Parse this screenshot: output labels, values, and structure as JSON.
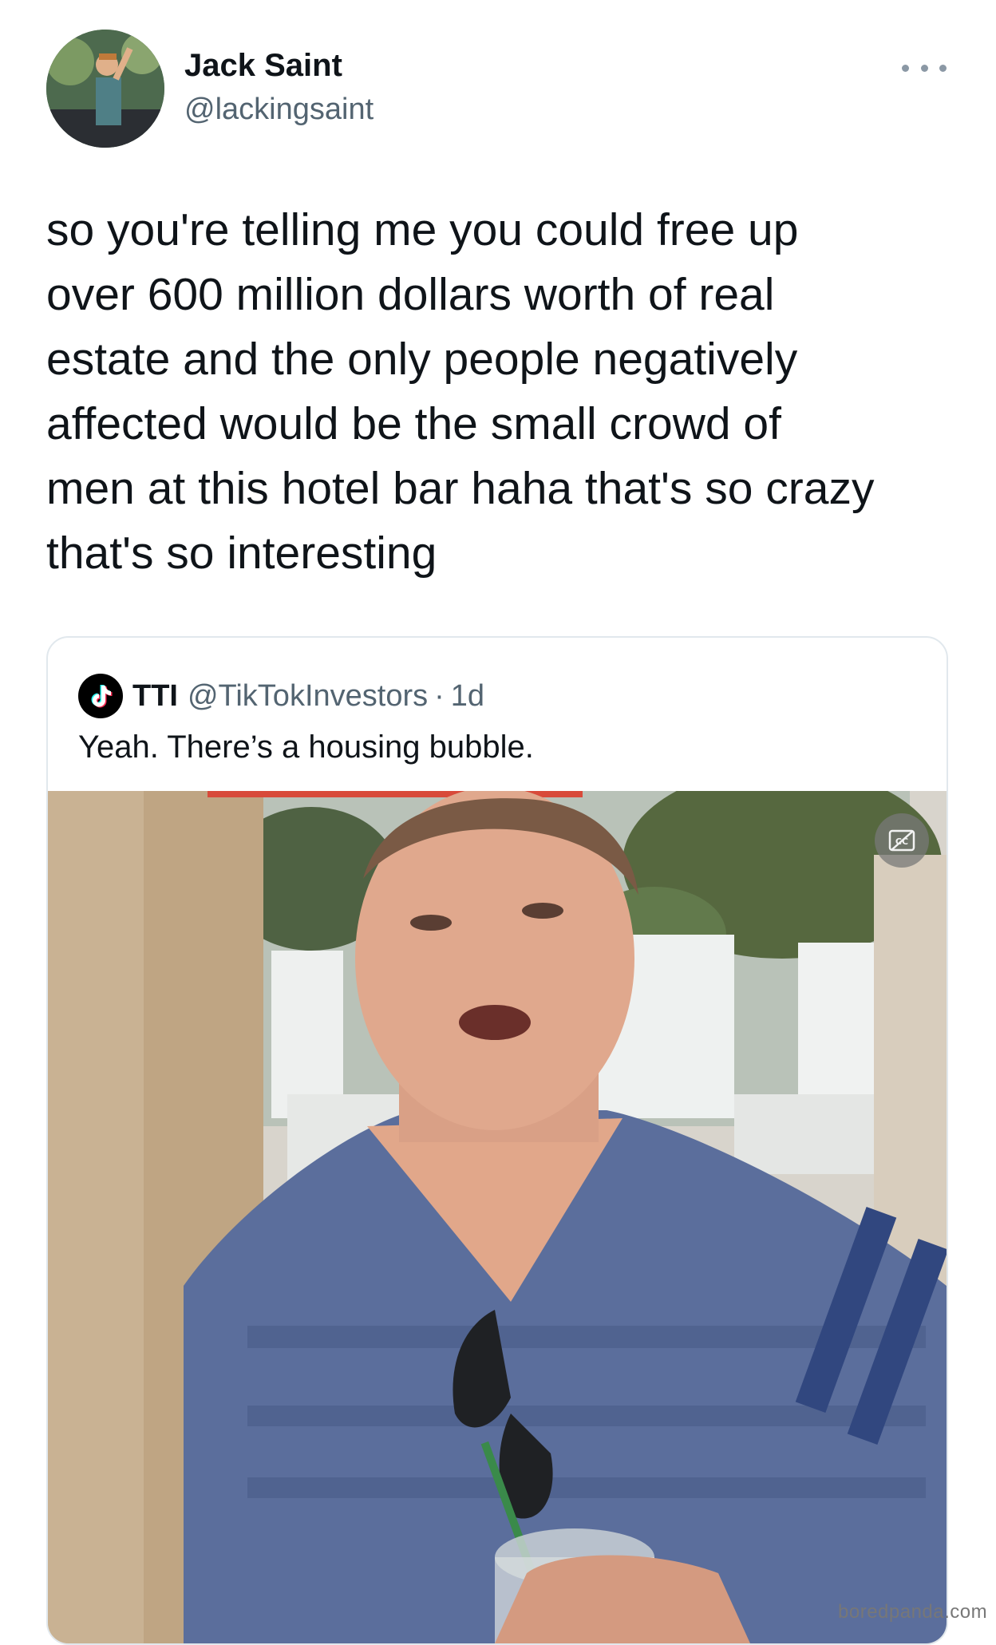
{
  "author": {
    "name": "Jack Saint",
    "handle": "@lackingsaint"
  },
  "tweet": {
    "text": "so you're telling me you could free up\nover 600 million dollars worth of real\nestate and the only people negatively\naffected would be the small crowd of\nmen at this hotel bar haha that's so crazy\nthat's so interesting"
  },
  "quoted_tweet": {
    "name": "TTI",
    "handle": "@TikTokInvestors",
    "separator": "·",
    "time": "1d",
    "text": "Yeah. There’s a housing bubble.",
    "icon": "tiktok-icon",
    "media_icon": "closed-captions-icon"
  },
  "watermark": "boredpanda.com",
  "colors": {
    "text": "#0f1419",
    "secondary": "#536471",
    "border": "#e1e8ed"
  }
}
